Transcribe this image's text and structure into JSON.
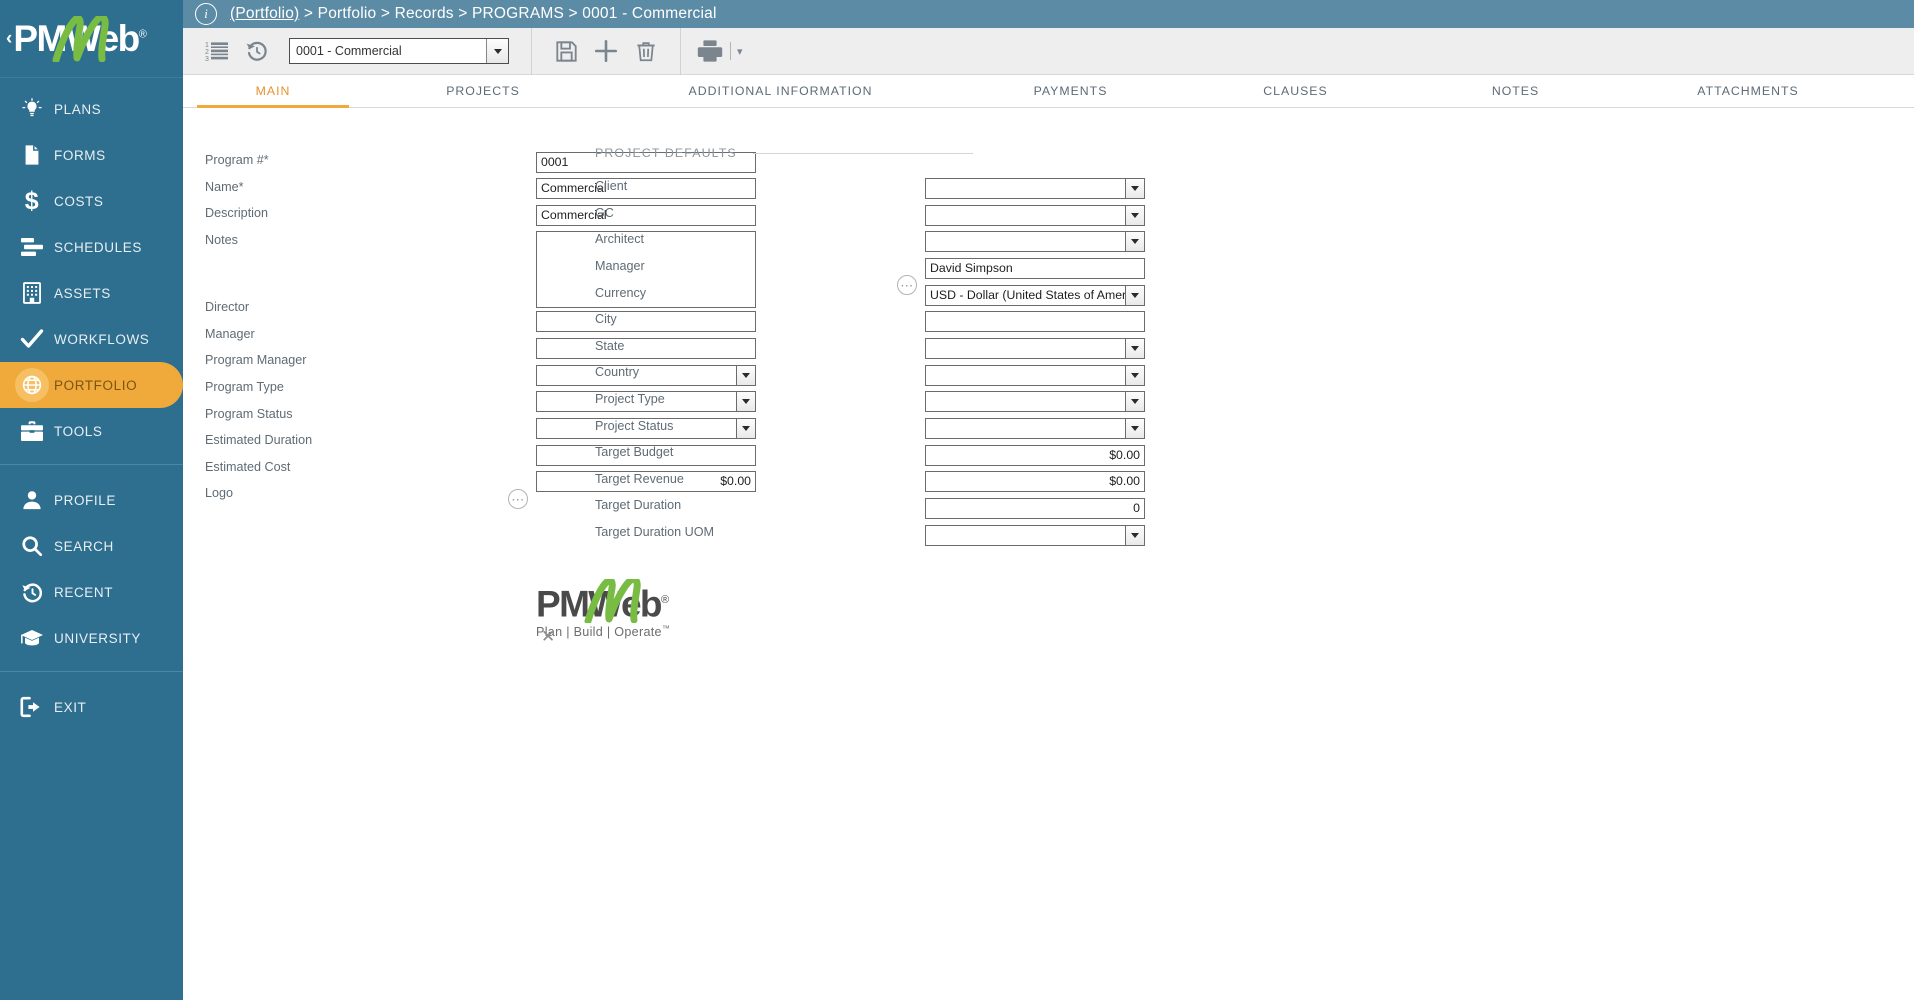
{
  "brand": {
    "name": "PMWeb",
    "registered": "®",
    "collapse_chevron": "‹"
  },
  "sidebar": {
    "groups": [
      {
        "items": [
          {
            "label": "PLANS",
            "icon": "lightbulb-icon",
            "active": false
          },
          {
            "label": "FORMS",
            "icon": "document-icon",
            "active": false
          },
          {
            "label": "COSTS",
            "icon": "dollar-icon",
            "active": false
          },
          {
            "label": "SCHEDULES",
            "icon": "gantt-icon",
            "active": false
          },
          {
            "label": "ASSETS",
            "icon": "building-icon",
            "active": false
          },
          {
            "label": "WORKFLOWS",
            "icon": "checkmark-icon",
            "active": false
          },
          {
            "label": "PORTFOLIO",
            "icon": "globe-icon",
            "active": true
          },
          {
            "label": "TOOLS",
            "icon": "toolbox-icon",
            "active": false
          }
        ]
      },
      {
        "items": [
          {
            "label": "PROFILE",
            "icon": "person-icon",
            "active": false
          },
          {
            "label": "SEARCH",
            "icon": "magnifier-icon",
            "active": false
          },
          {
            "label": "RECENT",
            "icon": "history-clock-icon",
            "active": false
          },
          {
            "label": "UNIVERSITY",
            "icon": "graduation-cap-icon",
            "active": false
          }
        ]
      },
      {
        "items": [
          {
            "label": "EXIT",
            "icon": "exit-door-icon",
            "active": false
          }
        ]
      }
    ]
  },
  "breadcrumb": {
    "info_glyph": "i",
    "root": "(Portfolio)",
    "separator": ">",
    "trail": [
      "Portfolio",
      "Records",
      "PROGRAMS",
      "0001 - Commercial"
    ],
    "full_text": "(Portfolio) > Portfolio > Records > PROGRAMS > 0001 – Commercial"
  },
  "toolbar": {
    "list_button": "list-icon",
    "history_button": "history-icon",
    "record_select_value": "0001 - Commercial",
    "save_button": "save-icon",
    "add_button": "add-icon",
    "delete_button": "trash-icon",
    "print_button": "print-icon",
    "print_caret": "▾"
  },
  "tabs": [
    {
      "label": "MAIN",
      "active": true
    },
    {
      "label": "PROJECTS",
      "active": false
    },
    {
      "label": "ADDITIONAL INFORMATION",
      "active": false
    },
    {
      "label": "PAYMENTS",
      "active": false
    },
    {
      "label": "CLAUSES",
      "active": false
    },
    {
      "label": "NOTES",
      "active": false
    },
    {
      "label": "ATTACHMENTS",
      "active": false
    }
  ],
  "form": {
    "left": [
      {
        "label": "Program #*",
        "type": "text",
        "value": "0001"
      },
      {
        "label": "Name*",
        "type": "text",
        "value": "Commercial"
      },
      {
        "label": "Description",
        "type": "text",
        "value": "Commercial"
      },
      {
        "label": "Notes",
        "type": "textarea",
        "value": ""
      },
      {
        "label": "Director",
        "type": "text",
        "value": ""
      },
      {
        "label": "Manager",
        "type": "text",
        "value": ""
      },
      {
        "label": "Program Manager",
        "type": "select",
        "value": ""
      },
      {
        "label": "Program Type",
        "type": "select",
        "value": ""
      },
      {
        "label": "Program Status",
        "type": "select",
        "value": ""
      },
      {
        "label": "Estimated Duration",
        "type": "text",
        "value": ""
      },
      {
        "label": "Estimated Cost",
        "type": "currency",
        "value": "$0.00"
      },
      {
        "label": "Logo",
        "type": "logo",
        "value": ""
      }
    ],
    "right_section_title": "PROJECT DEFAULTS",
    "right": [
      {
        "label": "Client",
        "type": "select",
        "value": ""
      },
      {
        "label": "GC",
        "type": "select",
        "value": ""
      },
      {
        "label": "Architect",
        "type": "select",
        "value": ""
      },
      {
        "label": "Manager",
        "type": "text",
        "value": "David Simpson"
      },
      {
        "label": "Currency",
        "type": "select",
        "value": "USD - Dollar (United States of Ameri",
        "has_ellipsis": true
      },
      {
        "label": "City",
        "type": "text",
        "value": ""
      },
      {
        "label": "State",
        "type": "select",
        "value": ""
      },
      {
        "label": "Country",
        "type": "select",
        "value": ""
      },
      {
        "label": "Project Type",
        "type": "select",
        "value": ""
      },
      {
        "label": "Project Status",
        "type": "select",
        "value": ""
      },
      {
        "label": "Target Budget",
        "type": "currency",
        "value": "$0.00"
      },
      {
        "label": "Target Revenue",
        "type": "currency",
        "value": "$0.00"
      },
      {
        "label": "Target Duration",
        "type": "number",
        "value": "0"
      },
      {
        "label": "Target Duration UOM",
        "type": "select",
        "value": ""
      }
    ]
  },
  "logo_preview": {
    "name": "PMWeb",
    "registered": "®",
    "tagline": "Plan | Build | Operate",
    "tm": "™",
    "remove_glyph": "✕"
  },
  "colors": {
    "sidebar_bg": "#2e6e8e",
    "accent": "#f0a93b",
    "breadcrumb_bg": "#5b8ba5",
    "toolbar_bg": "#eeeeee",
    "logo_green": "#79bc43",
    "tab_active": "#e8932e"
  }
}
